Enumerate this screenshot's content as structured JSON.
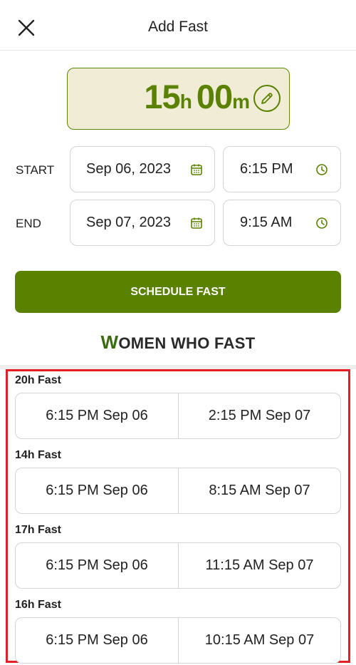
{
  "header": {
    "title": "Add Fast",
    "close_icon": "close-icon"
  },
  "duration": {
    "hours": "15",
    "hours_unit": "h",
    "minutes": "00",
    "minutes_unit": "m",
    "edit_icon": "pencil-icon"
  },
  "start": {
    "label": "START",
    "date": "Sep 06, 2023",
    "time": "6:15 PM"
  },
  "end": {
    "label": "END",
    "date": "Sep 07, 2023",
    "time": "9:15 AM"
  },
  "schedule_button": "SCHEDULE FAST",
  "brand": {
    "first_letter": "W",
    "rest": "OMEN WHO FAST"
  },
  "presets": [
    {
      "label": "20h Fast",
      "start": "6:15 PM Sep 06",
      "end": "2:15 PM Sep 07"
    },
    {
      "label": "14h Fast",
      "start": "6:15 PM Sep 06",
      "end": "8:15 AM Sep 07"
    },
    {
      "label": "17h Fast",
      "start": "6:15 PM Sep 06",
      "end": "11:15 AM Sep 07"
    },
    {
      "label": "16h Fast",
      "start": "6:15 PM Sep 06",
      "end": "10:15 AM Sep 07"
    }
  ],
  "colors": {
    "accent": "#5a8200",
    "duration_bg": "#f0ecd5",
    "highlight": "#e31e24"
  }
}
